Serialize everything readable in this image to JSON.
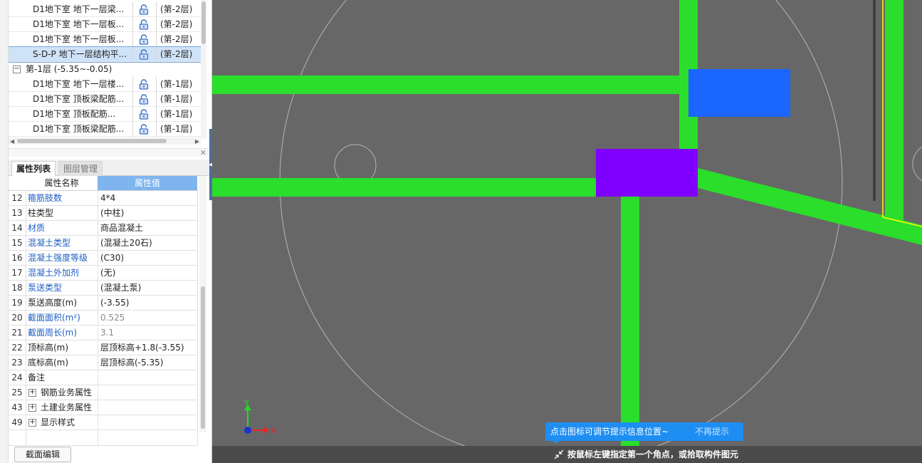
{
  "layer_tree": {
    "items": [
      {
        "name": "D1地下室 地下一层梁...",
        "floor": "(第-2层)",
        "type": "sub"
      },
      {
        "name": "D1地下室 地下一层板...",
        "floor": "(第-2层)",
        "type": "sub"
      },
      {
        "name": "D1地下室 地下一层板...",
        "floor": "(第-2层)",
        "type": "sub"
      },
      {
        "name": "S-D-P 地下一层结构平...",
        "floor": "(第-2层)",
        "type": "sub",
        "selected": true
      },
      {
        "name": "第-1层 (-5.35~-0.05)",
        "expander": "−",
        "type": "group"
      },
      {
        "name": "D1地下室 地下一层楼...",
        "floor": "(第-1层)",
        "type": "sub"
      },
      {
        "name": "D1地下室 顶板梁配筋...",
        "floor": "(第-1层)",
        "type": "sub"
      },
      {
        "name": "D1地下室 顶板配筋...",
        "floor": "(第-1层)",
        "type": "sub"
      },
      {
        "name": "D1地下室 顶板梁配筋...",
        "floor": "(第-1层)",
        "type": "sub"
      }
    ]
  },
  "tabs": {
    "properties": "属性列表",
    "layers": "图层管理"
  },
  "property_table": {
    "header_name": "属性名称",
    "header_value": "属性值",
    "rows": [
      {
        "num": "12",
        "name": "箍筋肢数",
        "value": "4*4",
        "style": "link"
      },
      {
        "num": "13",
        "name": "柱类型",
        "value": "(中柱)",
        "style": "normal"
      },
      {
        "num": "14",
        "name": "材质",
        "value": "商品混凝土",
        "style": "link"
      },
      {
        "num": "15",
        "name": "混凝土类型",
        "value": "(混凝土20石)",
        "style": "link"
      },
      {
        "num": "16",
        "name": "混凝土强度等级",
        "value": "(C30)",
        "style": "link"
      },
      {
        "num": "17",
        "name": "混凝土外加剂",
        "value": "(无)",
        "style": "link"
      },
      {
        "num": "18",
        "name": "泵送类型",
        "value": "(混凝土泵)",
        "style": "link"
      },
      {
        "num": "19",
        "name": "泵送高度(m)",
        "value": "(-3.55)",
        "style": "normal"
      },
      {
        "num": "20",
        "name": "截面面积(m²)",
        "value": "0.525",
        "style": "link-gray"
      },
      {
        "num": "21",
        "name": "截面周长(m)",
        "value": "3.1",
        "style": "link-gray"
      },
      {
        "num": "22",
        "name": "顶标高(m)",
        "value": "层顶标高+1.8(-3.55)",
        "style": "normal"
      },
      {
        "num": "23",
        "name": "底标高(m)",
        "value": "层顶标高(-5.35)",
        "style": "normal"
      },
      {
        "num": "24",
        "name": "备注",
        "value": "",
        "style": "normal"
      },
      {
        "num": "25",
        "name": "钢筋业务属性",
        "value": "",
        "style": "group",
        "expander": "+"
      },
      {
        "num": "43",
        "name": "土建业务属性",
        "value": "",
        "style": "group",
        "expander": "+"
      },
      {
        "num": "49",
        "name": "显示样式",
        "value": "",
        "style": "group",
        "expander": "+"
      }
    ]
  },
  "buttons": {
    "section_edit": "截面编辑"
  },
  "viewport": {
    "axis_x_label": "X",
    "axis_y_label": "Y",
    "colors": {
      "background": "#676767",
      "beam": "#2bde2b",
      "column_blue": "#1a66ff",
      "column_purple": "#8000ff",
      "axis_circle": "#b5b5b5",
      "yellow_line": "#ffff00"
    }
  },
  "tooltip": {
    "message": "点击图标可调节提示信息位置~",
    "dismiss": "不再提示"
  },
  "status_bar": {
    "prompt": "按鼠标左键指定第一个角点，或拾取构件图元"
  }
}
